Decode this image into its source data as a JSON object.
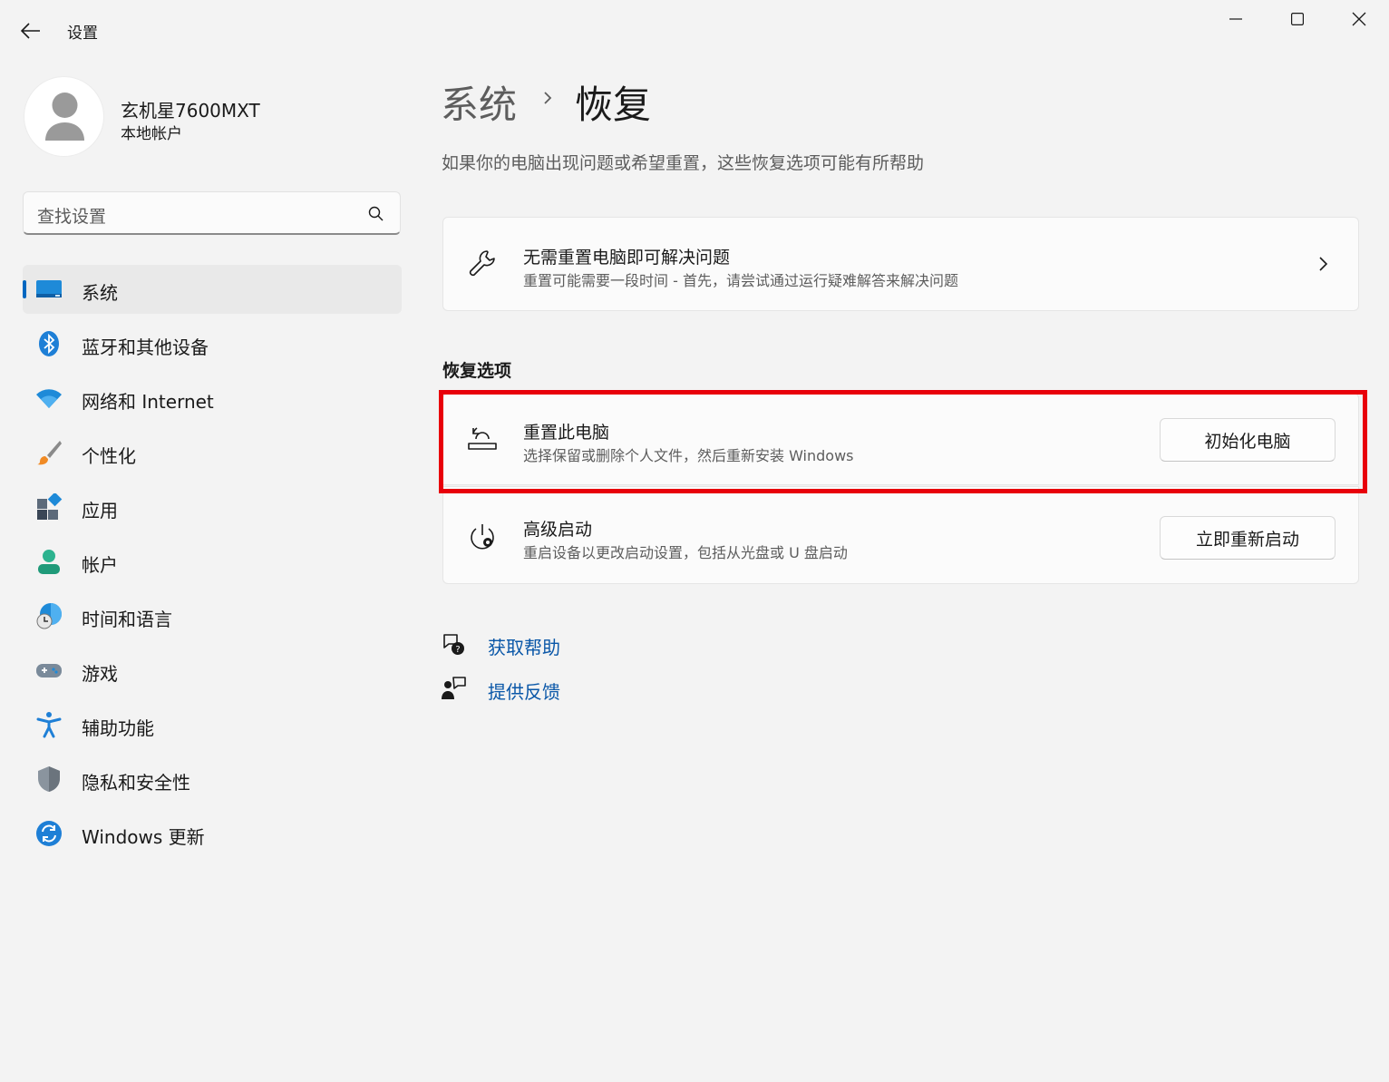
{
  "window": {
    "title": "设置"
  },
  "profile": {
    "name": "玄机星7600MXT",
    "account_type": "本地帐户"
  },
  "search": {
    "placeholder": "查找设置"
  },
  "sidebar": {
    "items": [
      {
        "label": "系统",
        "icon": "system-icon",
        "active": true
      },
      {
        "label": "蓝牙和其他设备",
        "icon": "bluetooth-icon",
        "active": false
      },
      {
        "label": "网络和 Internet",
        "icon": "wifi-icon",
        "active": false
      },
      {
        "label": "个性化",
        "icon": "brush-icon",
        "active": false
      },
      {
        "label": "应用",
        "icon": "apps-icon",
        "active": false
      },
      {
        "label": "帐户",
        "icon": "account-icon",
        "active": false
      },
      {
        "label": "时间和语言",
        "icon": "time-language-icon",
        "active": false
      },
      {
        "label": "游戏",
        "icon": "gamepad-icon",
        "active": false
      },
      {
        "label": "辅助功能",
        "icon": "accessibility-icon",
        "active": false
      },
      {
        "label": "隐私和安全性",
        "icon": "shield-icon",
        "active": false
      },
      {
        "label": "Windows 更新",
        "icon": "update-icon",
        "active": false
      }
    ]
  },
  "header": {
    "breadcrumb_parent": "系统",
    "breadcrumb_current": "恢复",
    "subtitle": "如果你的电脑出现问题或希望重置，这些恢复选项可能有所帮助"
  },
  "troubleshoot_card": {
    "title": "无需重置电脑即可解决问题",
    "description": "重置可能需要一段时间 - 首先，请尝试通过运行疑难解答来解决问题"
  },
  "recovery_options": {
    "section_title": "恢复选项",
    "reset": {
      "title": "重置此电脑",
      "description": "选择保留或删除个人文件，然后重新安装 Windows",
      "button": "初始化电脑"
    },
    "advanced": {
      "title": "高级启动",
      "description": "重启设备以更改启动设置，包括从光盘或 U 盘启动",
      "button": "立即重新启动"
    }
  },
  "help_links": {
    "get_help": "获取帮助",
    "feedback": "提供反馈"
  },
  "colors": {
    "accent": "#0067c0",
    "highlight_box": "#e8000a",
    "link": "#0a57a8"
  }
}
